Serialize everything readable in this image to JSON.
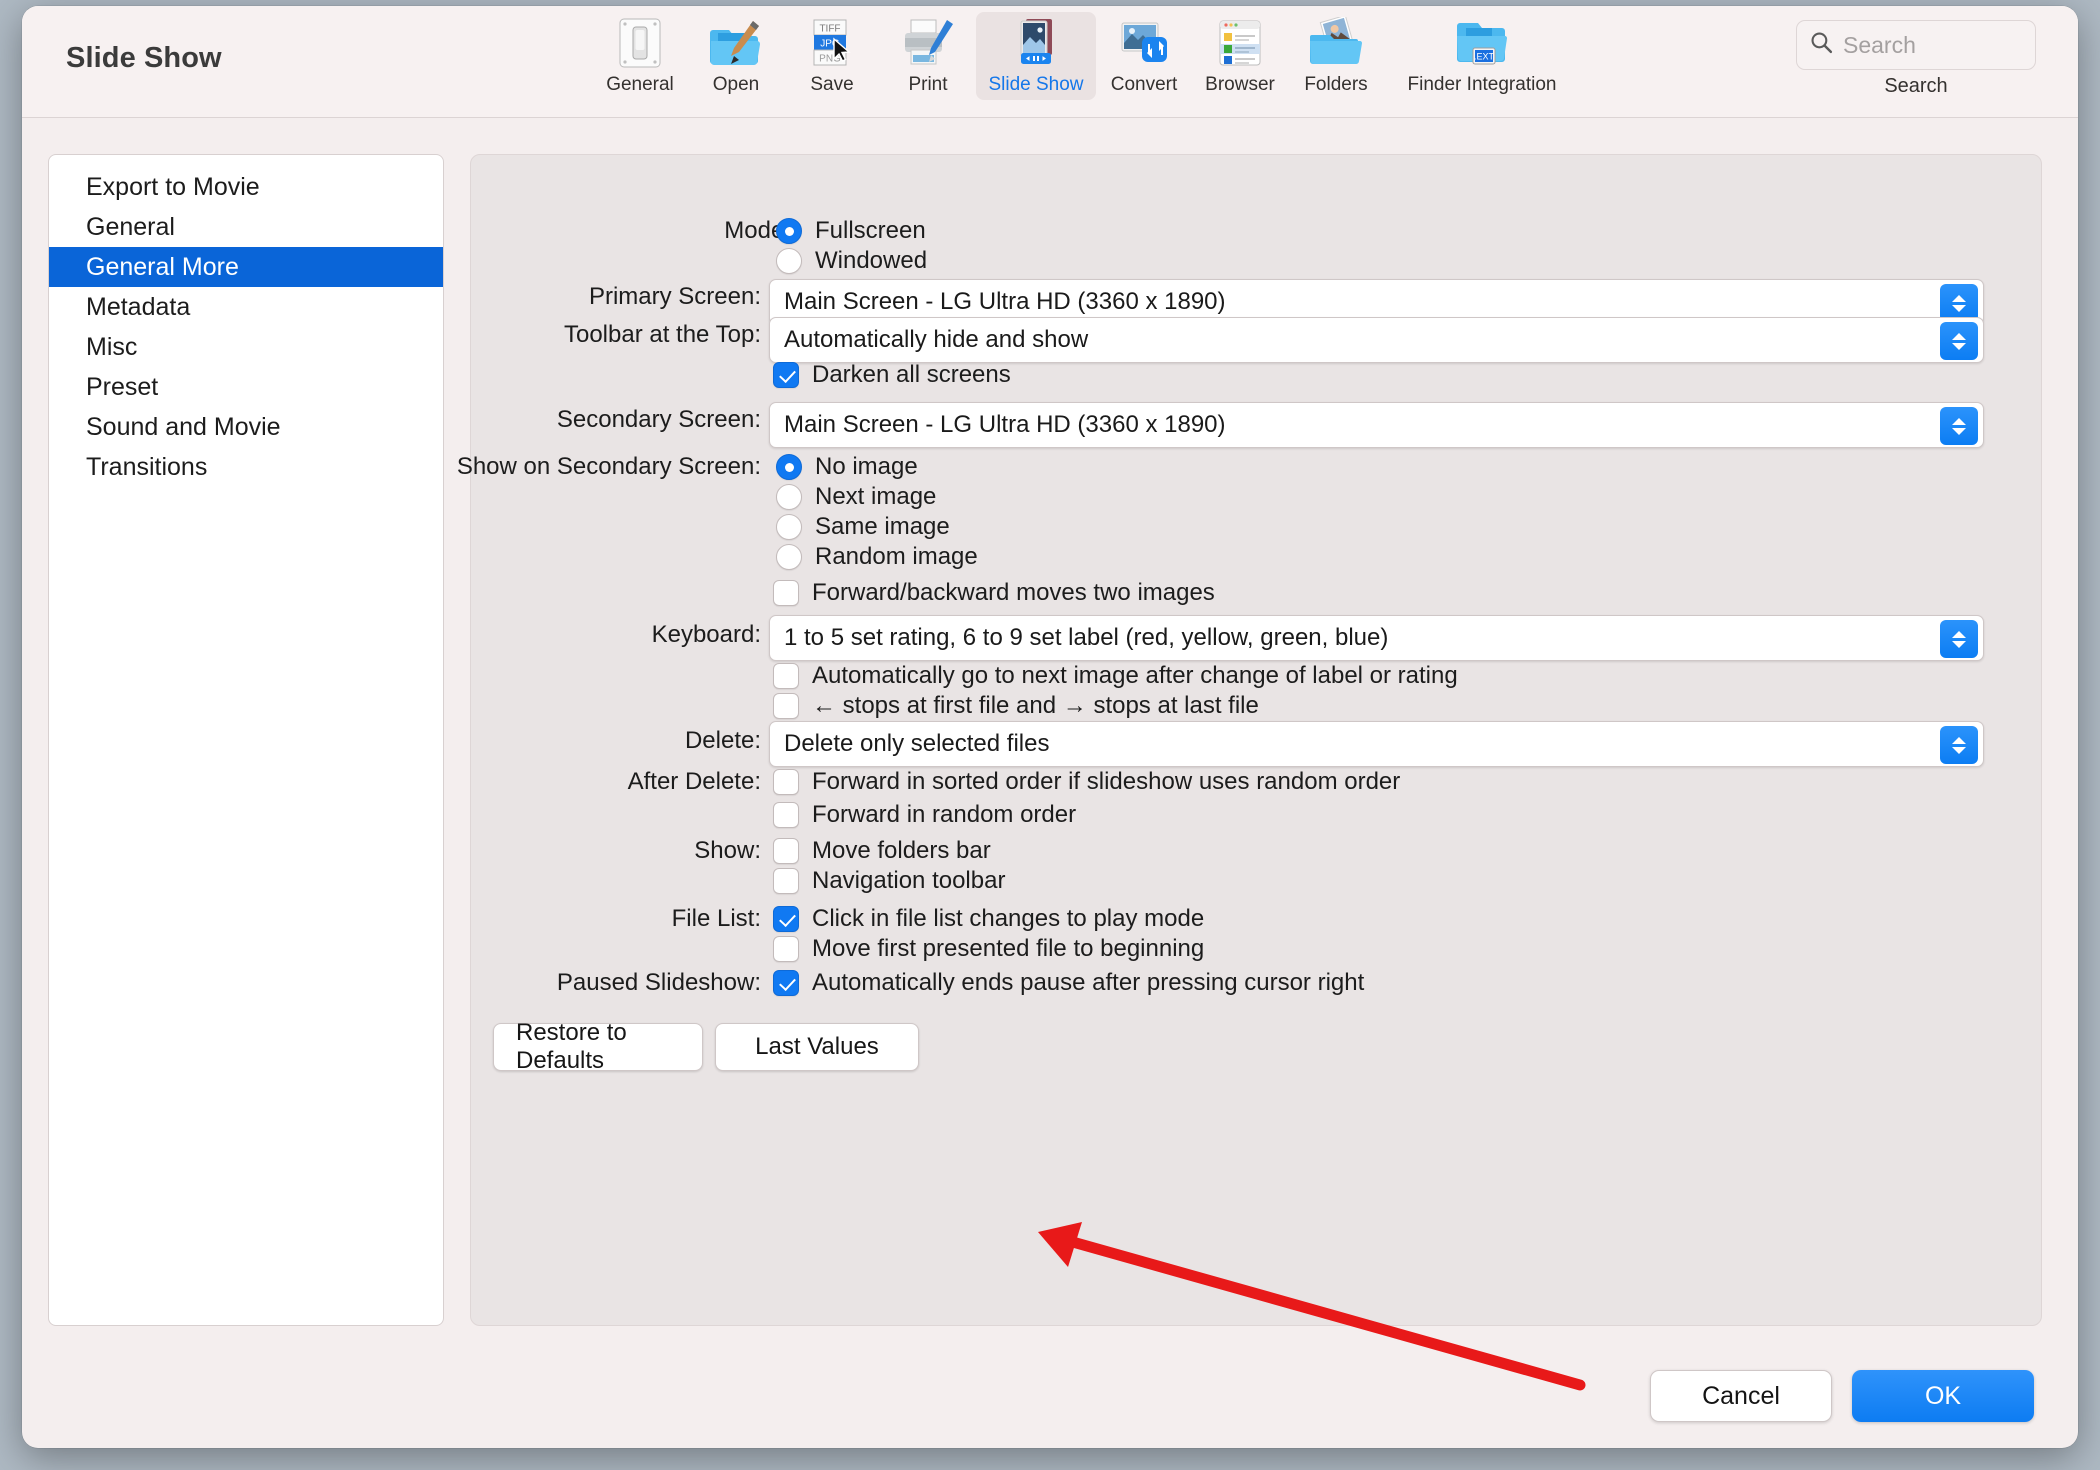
{
  "window": {
    "title": "Slide Show"
  },
  "toolbar": {
    "items": [
      {
        "label": "General",
        "icon": "switch-icon",
        "selected": false
      },
      {
        "label": "Open",
        "icon": "folder-brush-icon",
        "selected": false
      },
      {
        "label": "Save",
        "icon": "file-formats-icon",
        "selected": false
      },
      {
        "label": "Print",
        "icon": "printer-icon",
        "selected": false
      },
      {
        "label": "Slide Show",
        "icon": "slideshow-icon",
        "selected": true
      },
      {
        "label": "Convert",
        "icon": "convert-image-icon",
        "selected": false
      },
      {
        "label": "Browser",
        "icon": "browser-window-icon",
        "selected": false
      },
      {
        "label": "Folders",
        "icon": "photo-folder-icon",
        "selected": false
      },
      {
        "label": "Finder Integration",
        "icon": "finder-ext-icon",
        "selected": false
      }
    ],
    "search": {
      "placeholder": "Search",
      "caption": "Search",
      "icon": "search-icon"
    }
  },
  "sidebar": {
    "items": [
      {
        "label": "Export to Movie",
        "selected": false
      },
      {
        "label": "General",
        "selected": false
      },
      {
        "label": "General More",
        "selected": true
      },
      {
        "label": "Metadata",
        "selected": false
      },
      {
        "label": "Misc",
        "selected": false
      },
      {
        "label": "Preset",
        "selected": false
      },
      {
        "label": "Sound and Movie",
        "selected": false
      },
      {
        "label": "Transitions",
        "selected": false
      }
    ]
  },
  "settings": {
    "mode": {
      "label": "Mode:",
      "options": [
        {
          "label": "Fullscreen",
          "selected": true
        },
        {
          "label": "Windowed",
          "selected": false
        }
      ]
    },
    "primary_screen": {
      "label": "Primary Screen:",
      "value": "Main Screen - LG Ultra HD (3360 x 1890)"
    },
    "toolbar_at_top": {
      "label": "Toolbar at the Top:",
      "value": "Automatically hide and show"
    },
    "darken_all_screens": {
      "label": "Darken all screens",
      "checked": true
    },
    "secondary_screen": {
      "label": "Secondary Screen:",
      "value": "Main Screen - LG Ultra HD (3360 x 1890)"
    },
    "show_on_secondary": {
      "label": "Show on Secondary Screen:",
      "options": [
        {
          "label": "No image",
          "selected": true
        },
        {
          "label": "Next image",
          "selected": false
        },
        {
          "label": "Same image",
          "selected": false
        },
        {
          "label": "Random image",
          "selected": false
        }
      ]
    },
    "forward_backward_two": {
      "label": "Forward/backward moves two images",
      "checked": false
    },
    "keyboard": {
      "label": "Keyboard:",
      "value": "1 to 5 set rating, 6 to 9 set label (red, yellow, green, blue)"
    },
    "auto_next_after_change": {
      "label": "Automatically go to next image after change of label or rating",
      "checked": false
    },
    "arrow_stops": {
      "label": "← stops at first file and → stops at last file",
      "checked": false
    },
    "delete": {
      "label": "Delete:",
      "value": "Delete only selected files"
    },
    "after_delete": {
      "label": "After Delete:",
      "options": [
        {
          "label": "Forward in sorted order if slideshow uses random order",
          "checked": false
        },
        {
          "label": "Forward in random order",
          "checked": false
        }
      ]
    },
    "show": {
      "label": "Show:",
      "options": [
        {
          "label": "Move folders bar",
          "checked": false
        },
        {
          "label": "Navigation toolbar",
          "checked": false
        }
      ]
    },
    "file_list": {
      "label": "File List:",
      "options": [
        {
          "label": "Click in file list changes to play mode",
          "checked": true
        },
        {
          "label": "Move first presented file to beginning",
          "checked": false
        }
      ]
    },
    "paused_slideshow": {
      "label": "Paused Slideshow:",
      "options": [
        {
          "label": "Automatically ends pause after pressing cursor right",
          "checked": true
        }
      ]
    }
  },
  "panel_buttons": {
    "restore_defaults": "Restore to Defaults",
    "last_values": "Last Values"
  },
  "dialog_buttons": {
    "cancel": "Cancel",
    "ok": "OK"
  },
  "annotation": {
    "type": "red-arrow",
    "color": "#e81919",
    "points_at": "paused-slideshow-checkbox"
  },
  "colors": {
    "accent": "#0a65d8",
    "control_blue": "#1079f2",
    "selected_tab_text": "#1577ea",
    "annotation_red": "#e81919",
    "window_bg": "#f4eeee",
    "panel_bg": "#e9e4e4"
  }
}
